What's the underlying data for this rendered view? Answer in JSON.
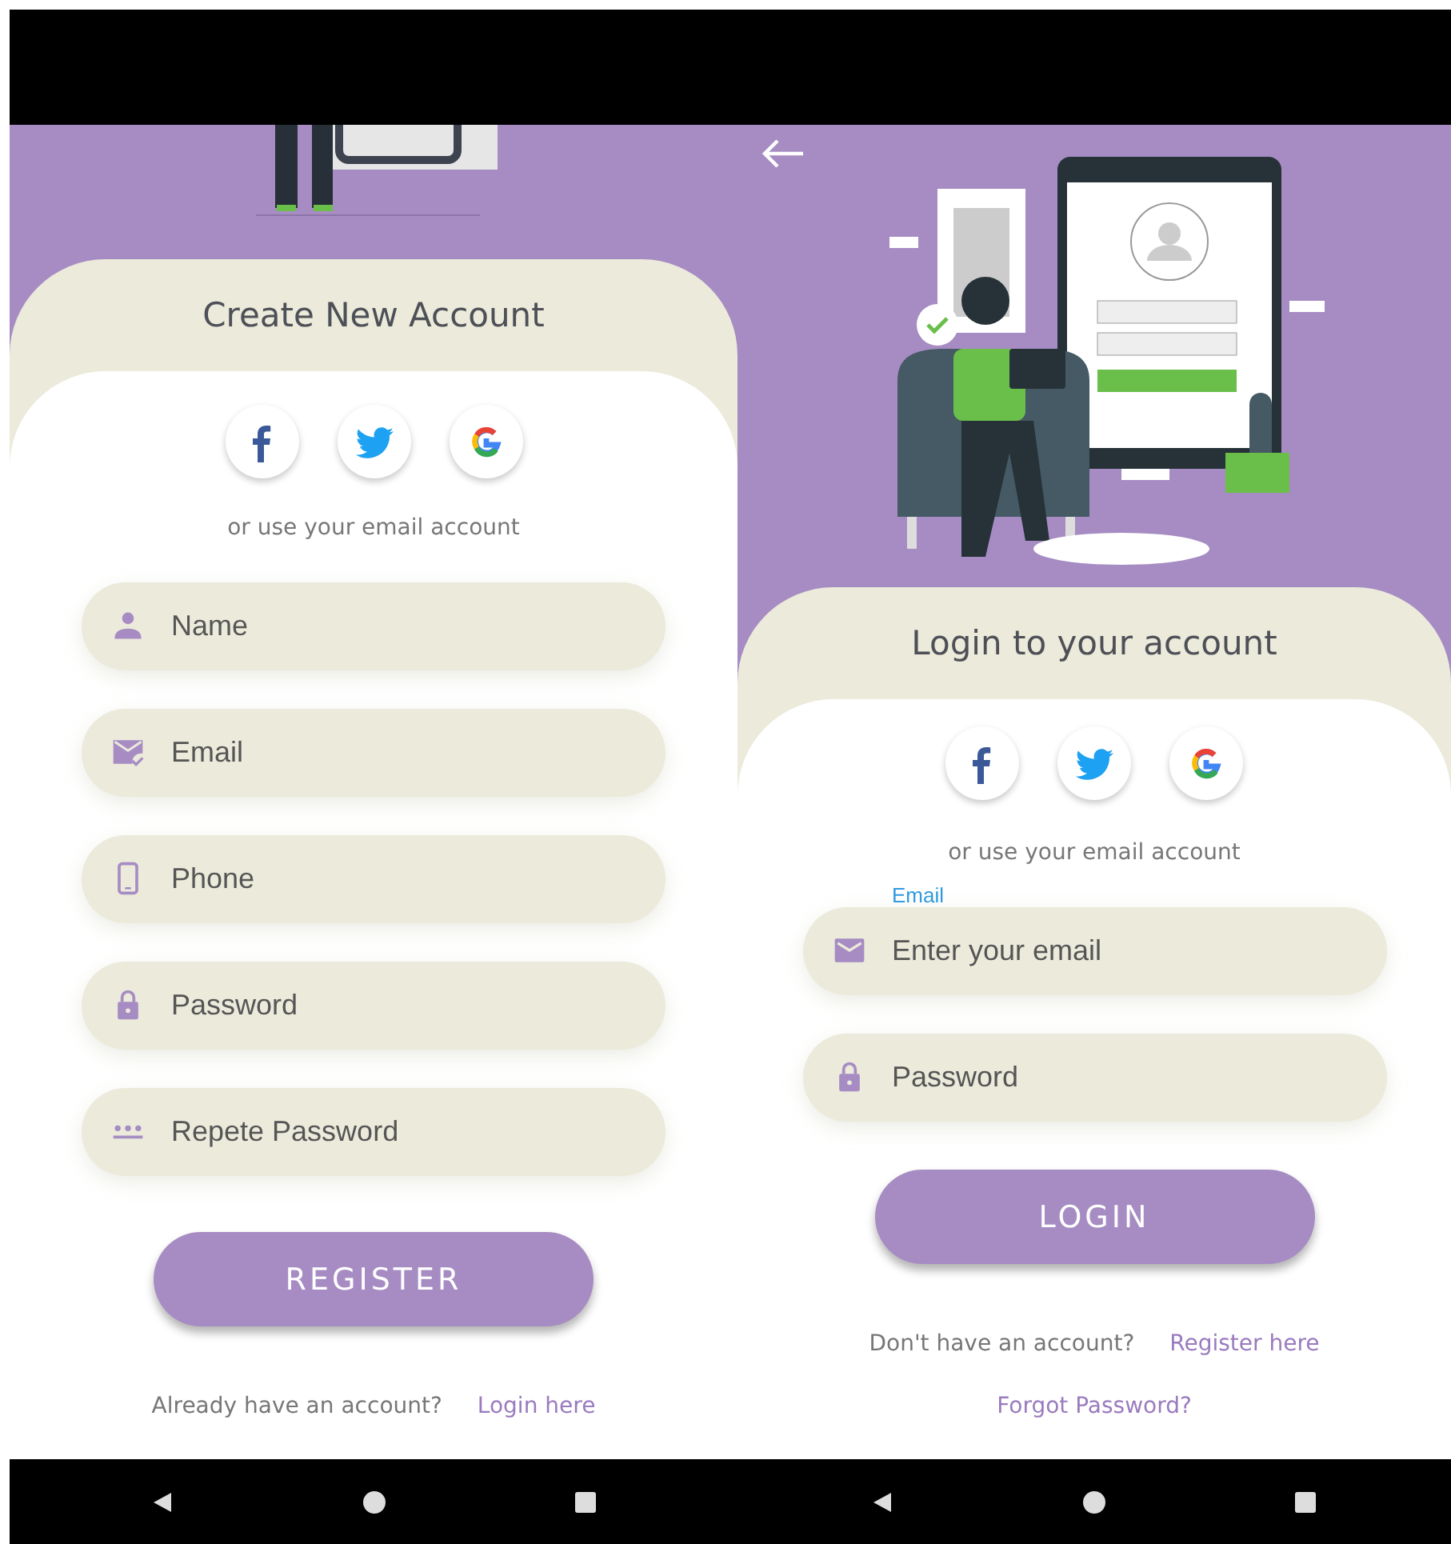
{
  "screens": [
    {
      "kind": "register",
      "hero": {
        "kind": "legs",
        "back": false
      },
      "title": "Create New Account",
      "social_buttons": [
        {
          "kind": "facebook"
        },
        {
          "kind": "twitter"
        },
        {
          "kind": "google"
        }
      ],
      "divider_text": "or use your email account",
      "fields": [
        {
          "kind": "name",
          "placeholder": "Name"
        },
        {
          "kind": "email-verified",
          "placeholder": "Email"
        },
        {
          "kind": "phone",
          "placeholder": "Phone"
        },
        {
          "kind": "password",
          "placeholder": "Password"
        },
        {
          "kind": "repeat-password",
          "placeholder": "Repete Password"
        }
      ],
      "button": "REGISTER",
      "prompt": {
        "text": "Already have an account?",
        "link": "Login here"
      }
    },
    {
      "kind": "login",
      "hero": {
        "kind": "reader",
        "back": true
      },
      "title": "Login to your account",
      "social_buttons": [
        {
          "kind": "facebook"
        },
        {
          "kind": "twitter"
        },
        {
          "kind": "google"
        }
      ],
      "divider_text": "or use your email account",
      "fields": [
        {
          "kind": "email",
          "label": "Email",
          "placeholder": "Enter your email"
        },
        {
          "kind": "password",
          "placeholder": "Password"
        }
      ],
      "button": "LOGIN",
      "prompt": {
        "text": "Don't have an account?",
        "link": "Register here"
      },
      "extra_link": "Forgot Password?"
    }
  ]
}
